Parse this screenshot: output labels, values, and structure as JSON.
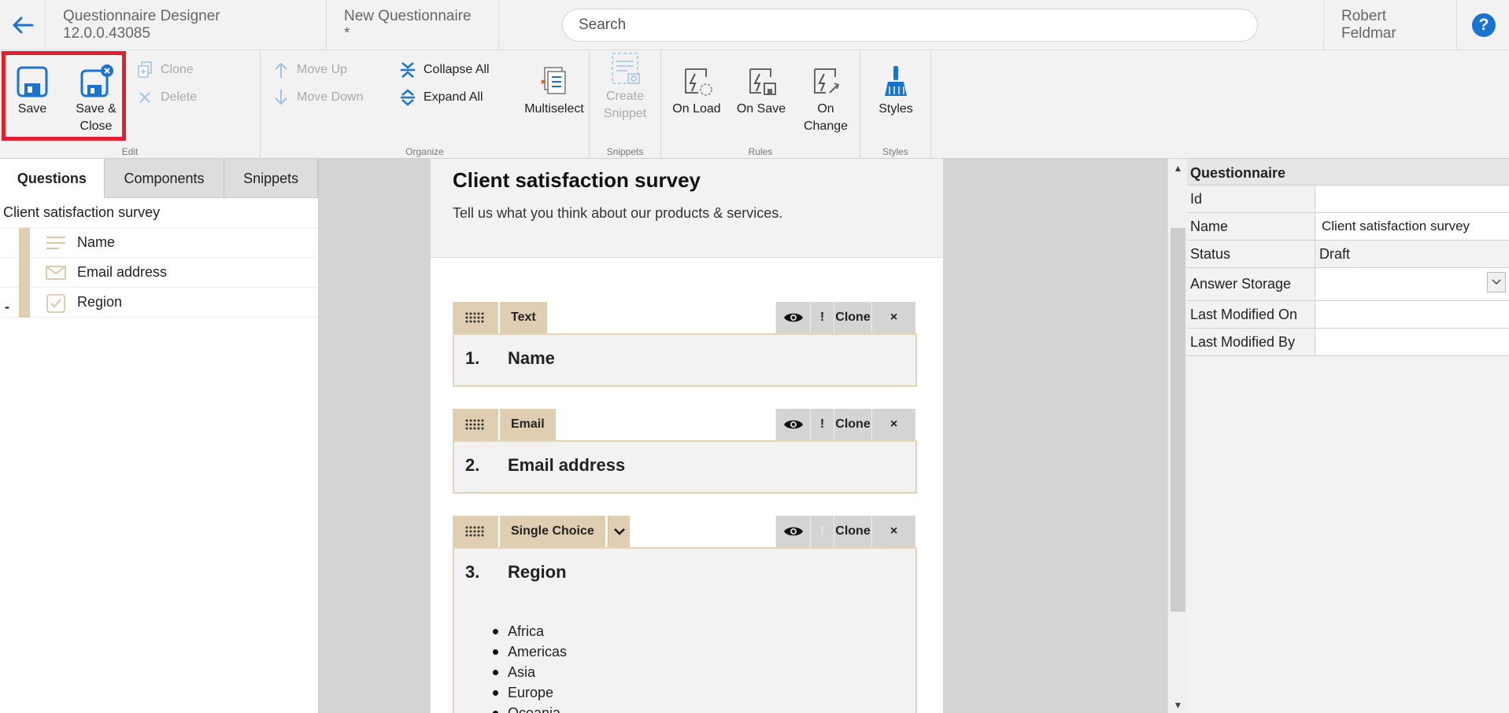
{
  "topbar": {
    "app_title": "Questionnaire Designer 12.0.0.43085",
    "doc_tab": "New Questionnaire *",
    "search_placeholder": "Search",
    "user_name": "Robert Feldmar",
    "help_label": "?"
  },
  "ribbon": {
    "edit": {
      "label": "Edit",
      "save": "Save",
      "save_close_1": "Save &",
      "save_close_2": "Close",
      "clone": "Clone",
      "delete": "Delete"
    },
    "organize": {
      "label": "Organize",
      "move_up": "Move Up",
      "move_down": "Move Down",
      "collapse_all": "Collapse All",
      "expand_all": "Expand All",
      "multiselect": "Multiselect"
    },
    "snippets": {
      "label": "Snippets",
      "create_1": "Create",
      "create_2": "Snippet"
    },
    "rules": {
      "label": "Rules",
      "on_load": "On Load",
      "on_save": "On Save",
      "on_change_1": "On",
      "on_change_2": "Change"
    },
    "styles": {
      "label": "Styles",
      "styles": "Styles"
    }
  },
  "left_panel": {
    "tabs": [
      "Questions",
      "Components",
      "Snippets"
    ],
    "root": "Client satisfaction survey",
    "items": [
      {
        "label": "Name",
        "icon": "text-lines-icon"
      },
      {
        "label": "Email address",
        "icon": "envelope-icon"
      },
      {
        "label": "Region",
        "icon": "checkbox-icon"
      }
    ],
    "collapse_marker": "-"
  },
  "document": {
    "title": "Client satisfaction survey",
    "description": "Tell us what you think about our products & services.",
    "clone_label": "Clone",
    "close_label": "×",
    "required_label": "!",
    "questions": [
      {
        "type": "Text",
        "number": "1.",
        "title": "Name"
      },
      {
        "type": "Email",
        "number": "2.",
        "title": "Email address"
      },
      {
        "type": "Single Choice",
        "number": "3.",
        "title": "Region",
        "options": [
          "Africa",
          "Americas",
          "Asia",
          "Europe",
          "Oceania"
        ]
      }
    ]
  },
  "properties": {
    "title": "Questionnaire",
    "rows": [
      {
        "key": "Id",
        "value": ""
      },
      {
        "key": "Name",
        "value": "Client satisfaction survey"
      },
      {
        "key": "Status",
        "value": "Draft"
      },
      {
        "key": "Answer Storage",
        "value": ""
      },
      {
        "key": "Last Modified On",
        "value": ""
      },
      {
        "key": "Last Modified By",
        "value": ""
      }
    ]
  },
  "colors": {
    "accent": "#1a73d0",
    "question_tag": "#e0ceb2",
    "highlight": "#e0202a"
  }
}
